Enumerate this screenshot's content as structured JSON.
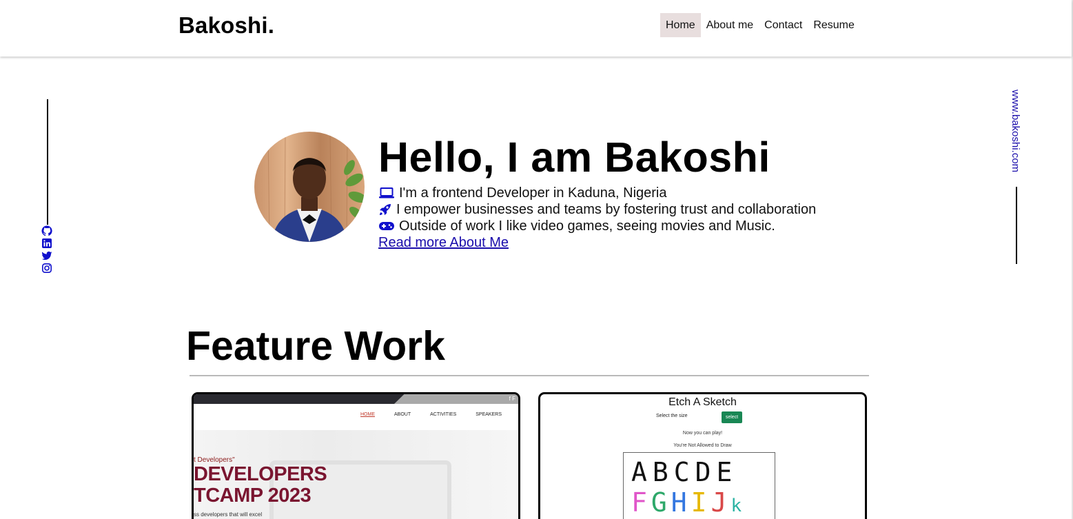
{
  "header": {
    "logo": "Bakoshi.",
    "nav": [
      {
        "label": "Home",
        "active": true
      },
      {
        "label": "About me",
        "active": false
      },
      {
        "label": "Contact",
        "active": false
      },
      {
        "label": "Resume",
        "active": false
      }
    ]
  },
  "socials": {
    "icons": [
      "github-icon",
      "linkedin-icon",
      "twitter-icon",
      "instagram-icon"
    ]
  },
  "side_link": "www.bakoshi.com",
  "hero": {
    "title": "Hello, I am Bakoshi",
    "lines": [
      {
        "icon": "laptop-icon",
        "text": "I'm a frontend Developer in Kaduna, Nigeria"
      },
      {
        "icon": "rocket-icon",
        "text": "I empower businesses and teams by fostering trust and collaboration"
      },
      {
        "icon": "gamepad-icon",
        "text": "Outside of work I like video games, seeing movies and Music."
      }
    ],
    "read_more": "Read more About Me"
  },
  "feature": {
    "title": "Feature Work",
    "card1": {
      "nav": [
        "HOME",
        "ABOUT",
        "ACTIVITIES",
        "SPEAKERS"
      ],
      "tagline": "t Developers\"",
      "headline_1": "DEVELOPERS",
      "headline_2": "TCAMP 2023",
      "caption": "ss developers that will excel",
      "fb": "f F"
    },
    "card2": {
      "title": "Etch A Sketch",
      "size_label": "Select the size",
      "select_button": "select",
      "msg1": "Now you can play!",
      "msg2": "You're Not Allowed to Draw",
      "row1": "ABCDE",
      "row2": [
        "F",
        "G",
        "H",
        "I",
        "J",
        "k"
      ]
    }
  },
  "colors": {
    "accent_link": "#1a0dab",
    "nav_active_bg": "#e8dede",
    "icon_blue": "#1010cc",
    "select_green": "#198754"
  }
}
